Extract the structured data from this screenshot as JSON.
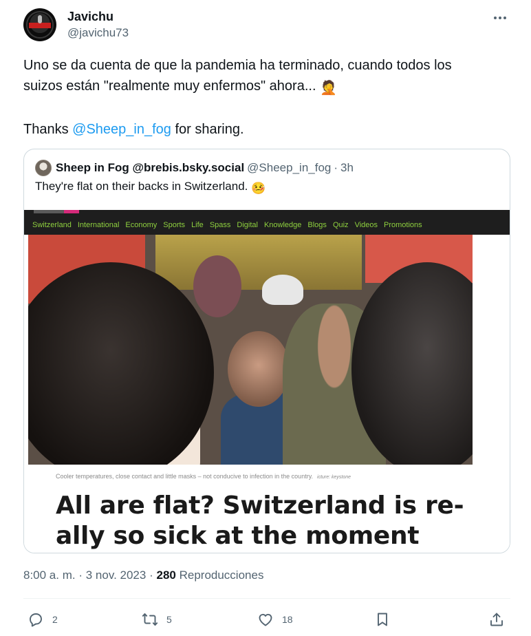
{
  "author": {
    "display_name": "Javichu",
    "handle": "@javichu73",
    "avatar_text": "EL RESPETO"
  },
  "tweet": {
    "line1": "Uno se da cuenta de que la pandemia ha terminado, cuando todos los",
    "line2": "suizos están \"realmente muy enfermos\" ahora...",
    "line2_emoji": "🤦",
    "line3_prefix": "Thanks ",
    "line3_mention": "@Sheep_in_fog",
    "line3_suffix": " for sharing."
  },
  "quote": {
    "display_name": "Sheep in Fog @brebis.bsky.social",
    "handle": "@Sheep_in_fog",
    "separator": "·",
    "time": "3h",
    "text": "They're flat on their backs in Switzerland.",
    "text_emoji": "🤒",
    "media": {
      "nav_items": [
        "Switzerland",
        "International",
        "Economy",
        "Sports",
        "Life",
        "Spass",
        "Digital",
        "Knowledge",
        "Blogs",
        "Quiz",
        "Videos",
        "Promotions"
      ],
      "caption": "Cooler temperatures, close contact and little masks – not conducive to infection in the country.",
      "caption_credit": "icture: keystone",
      "headline_line1": "All are flat? Switzerland is re-",
      "headline_line2": "ally so sick at the moment"
    }
  },
  "meta": {
    "time": "8:00 a. m.",
    "sep1": "·",
    "date": "3 nov. 2023",
    "sep2": "·",
    "views_count": "280",
    "views_label": "Reproducciones"
  },
  "actions": {
    "reply_icon": "reply-icon",
    "reply_count": "2",
    "retweet_icon": "retweet-icon",
    "retweet_count": "5",
    "like_icon": "heart-icon",
    "like_count": "18",
    "bookmark_icon": "bookmark-icon",
    "share_icon": "share-icon"
  },
  "colors": {
    "accent": "#1d9bf0",
    "text": "#0f1419",
    "secondary": "#536471",
    "nav_green": "#8fd13f"
  }
}
